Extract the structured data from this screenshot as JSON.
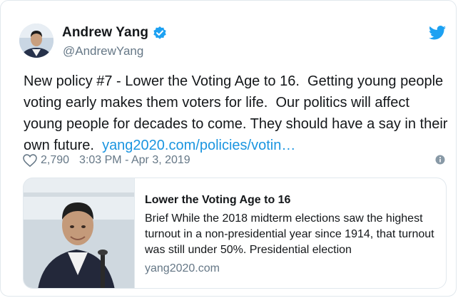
{
  "author": {
    "name": "Andrew Yang",
    "handle": "@AndrewYang"
  },
  "tweet": {
    "text": "New policy #7 - Lower the Voting Age to 16.  Getting young people voting early makes them voters for life.  Our politics will affect young people for decades to come. They should have a say in their own future.  ",
    "link": "yang2020.com/policies/votin…"
  },
  "meta": {
    "likes": "2,790",
    "timestamp": "3:03 PM - Apr 3, 2019"
  },
  "link_card": {
    "title": "Lower the Voting Age to 16",
    "description": "Brief While the 2018 midterm elections saw the highest turnout in a non-presidential year since 1914, that turnout was still under 50%. Presidential election",
    "domain": "yang2020.com"
  },
  "colors": {
    "link": "#1b95e0",
    "verified": "#1da1f2",
    "muted": "#657786",
    "border": "#e1e8ed"
  },
  "icons": [
    "avatar-photo",
    "verified-icon",
    "twitter-bird-icon",
    "heart-icon",
    "info-icon"
  ]
}
